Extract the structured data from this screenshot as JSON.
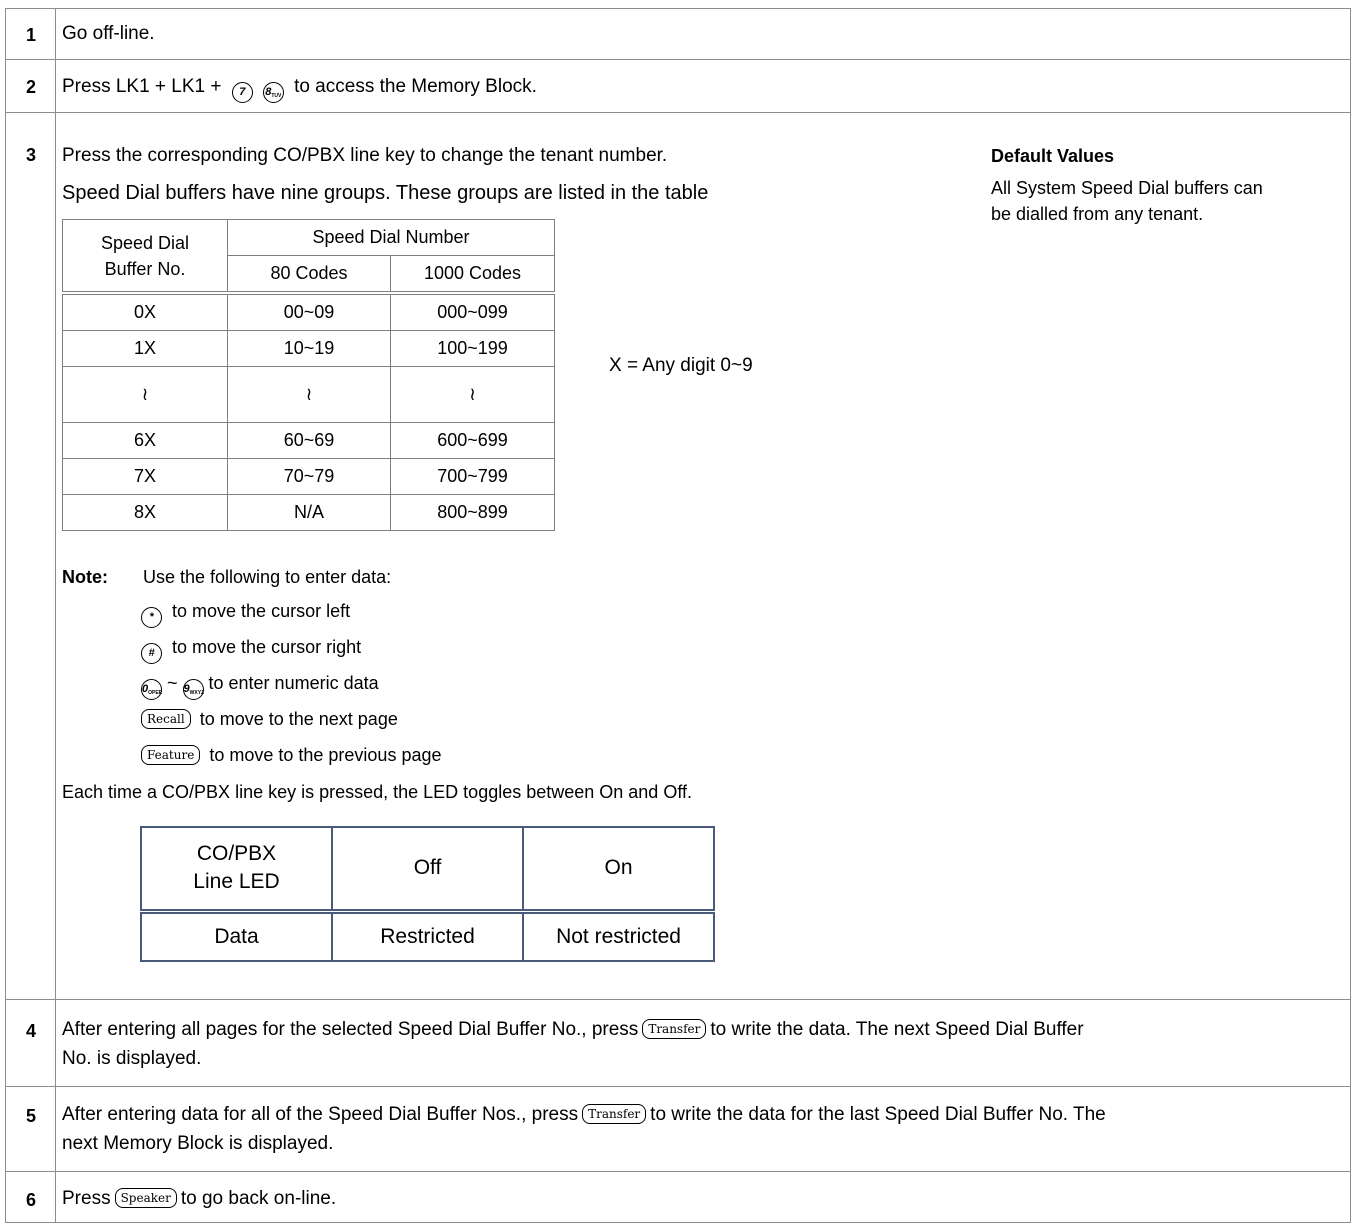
{
  "steps": [
    {
      "num": "1",
      "text": "Go off-line."
    },
    {
      "num": "2",
      "text_before": "Press LK1 + LK1 +",
      "key1": "7",
      "key2": "8",
      "key2_sub": "TUV",
      "text_after": "to access the Memory Block."
    },
    {
      "num": "3",
      "text": "Press the corresponding CO/PBX line key to change the tenant number.",
      "subtext": "Speed Dial buffers have nine groups. These groups are listed in the table"
    },
    {
      "num": "4",
      "line1_before": "After entering all pages for the selected Speed Dial Buffer No., press",
      "key": "Transfer",
      "line1_after": "to write the data. The next Speed Dial Buffer",
      "line2": "No. is displayed."
    },
    {
      "num": "5",
      "line1_before": "After entering data for all of the Speed Dial Buffer Nos., press",
      "key": "Transfer",
      "line1_after": "to write the data for the last Speed Dial Buffer No. The",
      "line2": "next Memory Block is displayed."
    },
    {
      "num": "6",
      "text_before": "Press",
      "key": "Speaker",
      "text_after": "to go back on-line."
    }
  ],
  "default_values": {
    "title": "Default Values",
    "line1": "All System Speed Dial buffers can",
    "line2": "be dialled from any tenant."
  },
  "speed_dial_table": {
    "col1_header_l1": "Speed Dial",
    "col1_header_l2": "Buffer No.",
    "group_header": "Speed Dial Number",
    "col2_header": "80 Codes",
    "col3_header": "1000 Codes",
    "rows": [
      [
        "0X",
        "00~09",
        "000~099"
      ],
      [
        "1X",
        "10~19",
        "100~199"
      ],
      [
        "≀",
        "≀",
        "≀"
      ],
      [
        "6X",
        "60~69",
        "600~699"
      ],
      [
        "7X",
        "70~79",
        "700~799"
      ],
      [
        "8X",
        "N/A",
        "800~899"
      ]
    ],
    "side_note": "X = Any digit 0~9"
  },
  "note": {
    "label": "Note:",
    "intro": "Use the following to enter data:",
    "star_key": "*",
    "star_text": "to move the cursor left",
    "hash_key": "#",
    "hash_text": "to move the cursor right",
    "zero_key": "0",
    "zero_sub": "OPER",
    "tilde": "~",
    "nine_key": "9",
    "nine_sub": "WXYZ",
    "num_text": "to enter numeric data",
    "recall_key": "Recall",
    "recall_text": "to move to the next page",
    "feature_key": "Feature",
    "feature_text": "to move to the previous page"
  },
  "toggle_text": "Each time a CO/PBX line key is pressed, the LED toggles between On and Off.",
  "led_table": {
    "h1_l1": "CO/PBX",
    "h1_l2": "Line LED",
    "h2": "Off",
    "h3": "On",
    "r1": "Data",
    "r2": "Restricted",
    "r3": "Not restricted"
  }
}
